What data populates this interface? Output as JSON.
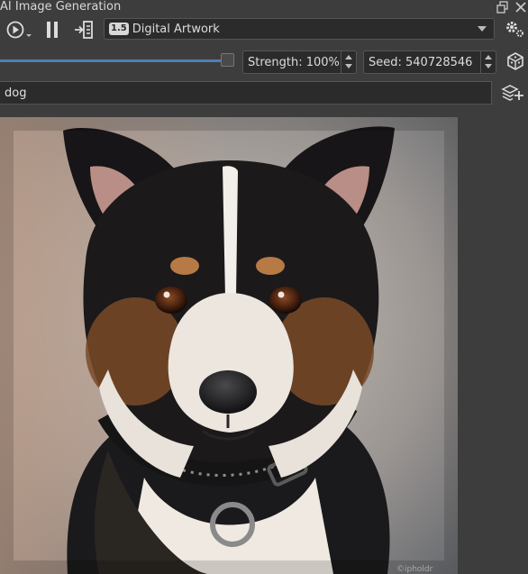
{
  "window": {
    "title": "AI Image Generation",
    "float_icon": "float-window-icon",
    "close_icon": "close-icon"
  },
  "toolbar": {
    "generate_icon": "play-icon",
    "pause_icon": "pause-icon",
    "queue_icon": "queue-icon",
    "style_badge": "1.5",
    "style_value": "Digital Artwork",
    "settings_icon": "gear-icon"
  },
  "params": {
    "strength_label": "Strength: 100%",
    "strength_value": 1.0,
    "seed_label": "Seed: 540728546",
    "seed_icon": "dice-icon"
  },
  "prompt": {
    "value": "dog",
    "add_region_icon": "add-layers-icon"
  },
  "result": {
    "subject": "dog-portrait-image",
    "watermark": "©ipholdr"
  },
  "colors": {
    "panel": "#3d3d3d",
    "field": "#2b2b2b",
    "accent": "#4f7fb0"
  }
}
